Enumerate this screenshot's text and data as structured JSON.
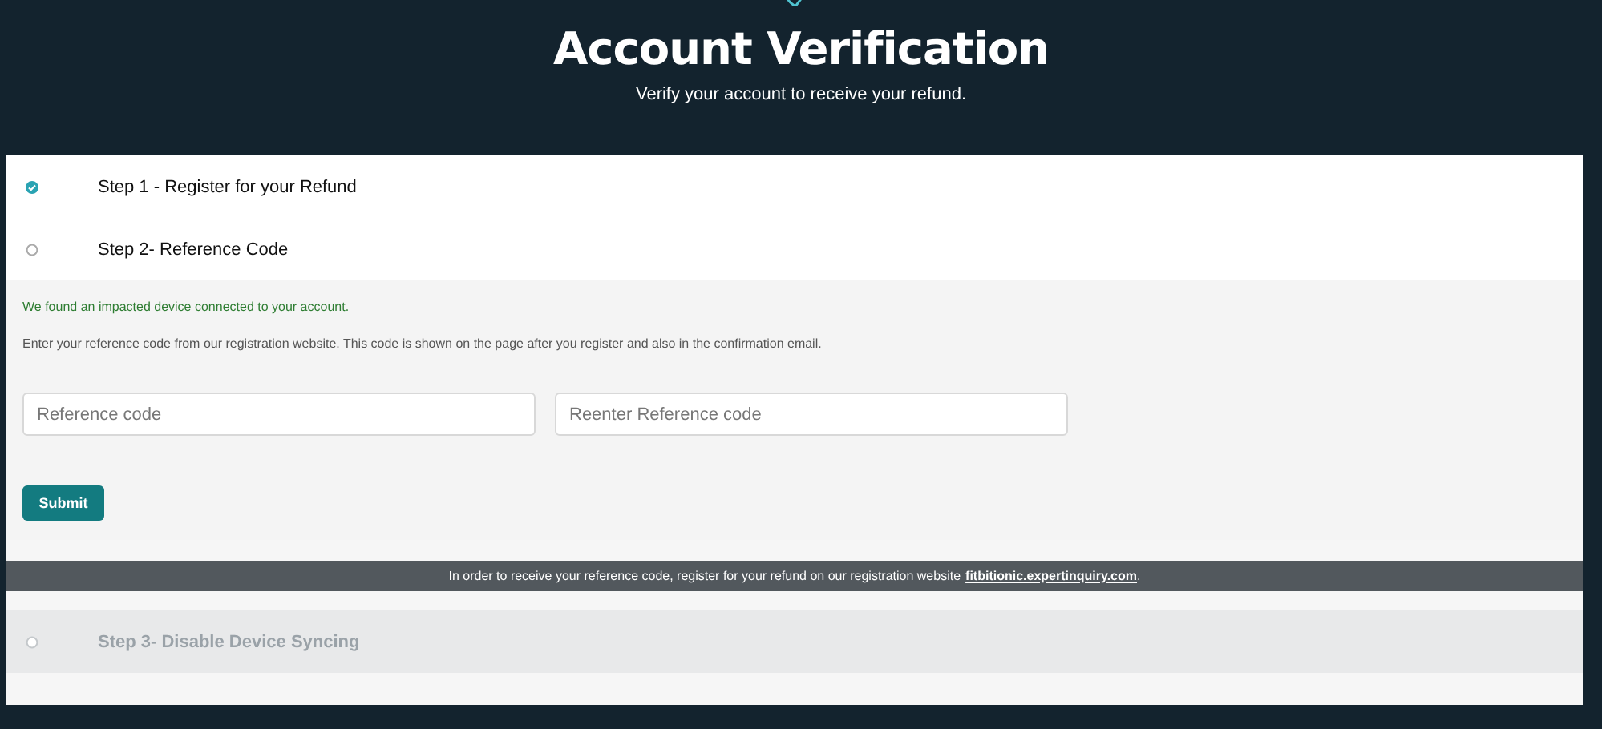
{
  "header": {
    "title": "Account Verification",
    "subtitle": "Verify your account to receive your refund."
  },
  "steps": [
    {
      "label": "Step 1 - Register for your Refund",
      "checked": true,
      "disabled": false
    },
    {
      "label": "Step 2- Reference Code",
      "checked": false,
      "disabled": false,
      "panel": {
        "notice": "We found an impacted device connected to your account.",
        "instructions": "Enter your reference code from our registration website. This code is shown on the page after you register and also in the confirmation email.",
        "fields": [
          {
            "placeholder": "Reference code"
          },
          {
            "placeholder": "Reenter Reference code"
          }
        ],
        "button": "Submit",
        "banner": {
          "text": "In order to receive your reference code, register for your refund on our registration website",
          "link": "fitbitionic.expertinquiry.com",
          "end": "."
        }
      }
    },
    {
      "label": "Step 3- Disable Device Syncing",
      "checked": false,
      "disabled": true
    }
  ]
}
